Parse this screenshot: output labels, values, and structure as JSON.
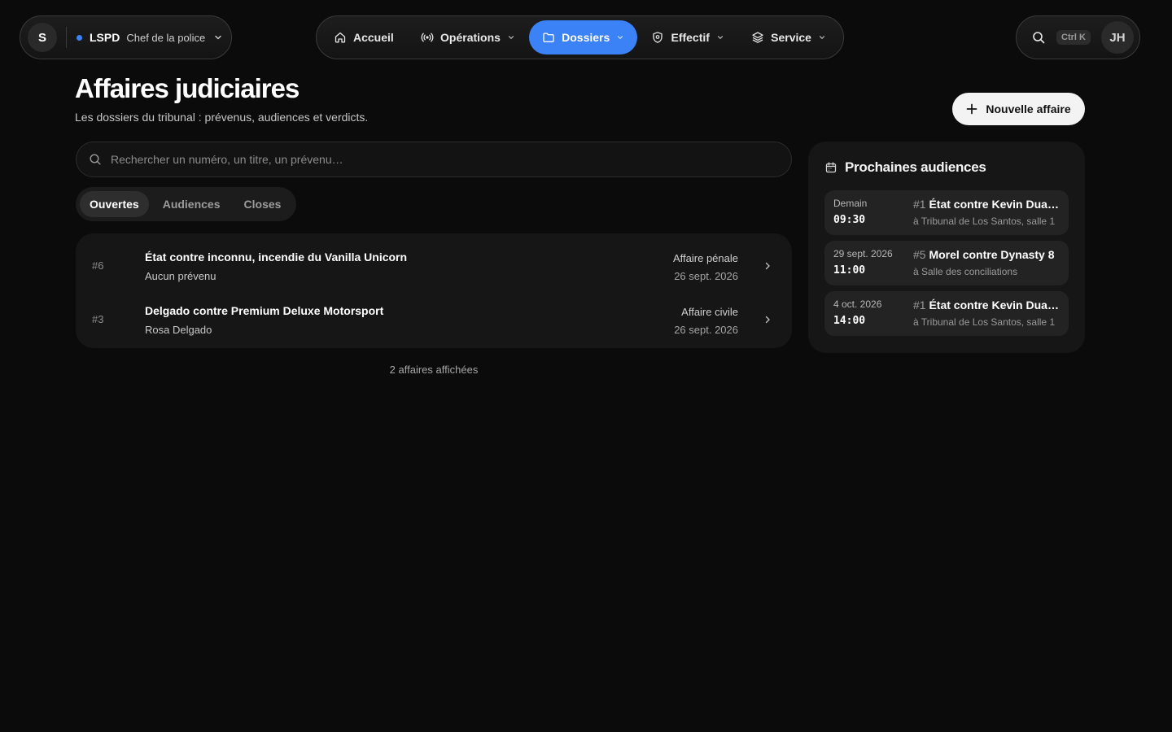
{
  "org": {
    "avatar": "S",
    "name": "LSPD",
    "role": "Chef de la police",
    "status_color": "#3b82f6"
  },
  "nav": {
    "items": [
      {
        "label": "Accueil",
        "icon": "home-icon"
      },
      {
        "label": "Opérations",
        "icon": "broadcast-icon"
      },
      {
        "label": "Dossiers",
        "icon": "folder-icon"
      },
      {
        "label": "Effectif",
        "icon": "shield-icon"
      },
      {
        "label": "Service",
        "icon": "layers-icon"
      }
    ],
    "active": "Dossiers",
    "accent": "#3b82f6"
  },
  "util": {
    "shortcut": "Ctrl K",
    "avatar": "JH"
  },
  "page": {
    "title": "Affaires judiciaires",
    "subtitle": "Les dossiers du tribunal : prévenus, audiences et verdicts.",
    "new_button": "Nouvelle affaire"
  },
  "search": {
    "placeholder": "Rechercher un numéro, un titre, un prévenu…",
    "value": ""
  },
  "tabs": {
    "items": [
      "Ouvertes",
      "Audiences",
      "Closes"
    ],
    "active": "Ouvertes"
  },
  "cases": [
    {
      "number": "#6",
      "title": "État contre inconnu, incendie du Vanilla Unicorn",
      "defendant": "Aucun prévenu",
      "kind": "Affaire pénale",
      "date": "26 sept. 2026"
    },
    {
      "number": "#3",
      "title": "Delgado contre Premium Deluxe Motorsport",
      "defendant": "Rosa Delgado",
      "kind": "Affaire civile",
      "date": "26 sept. 2026"
    }
  ],
  "count_label": "2 affaires affichées",
  "hearings": {
    "title": "Prochaines audiences",
    "items": [
      {
        "when": "Demain",
        "time": "09:30",
        "number": "#1",
        "case": "État contre Kevin Duarte",
        "location": "à Tribunal de Los Santos, salle 1"
      },
      {
        "when": "29 sept. 2026",
        "time": "11:00",
        "number": "#5",
        "case": "Morel contre Dynasty 8",
        "location": "à Salle des conciliations"
      },
      {
        "when": "4 oct. 2026",
        "time": "14:00",
        "number": "#1",
        "case": "État contre Kevin Duarte",
        "location": "à Tribunal de Los Santos, salle 1"
      }
    ]
  }
}
